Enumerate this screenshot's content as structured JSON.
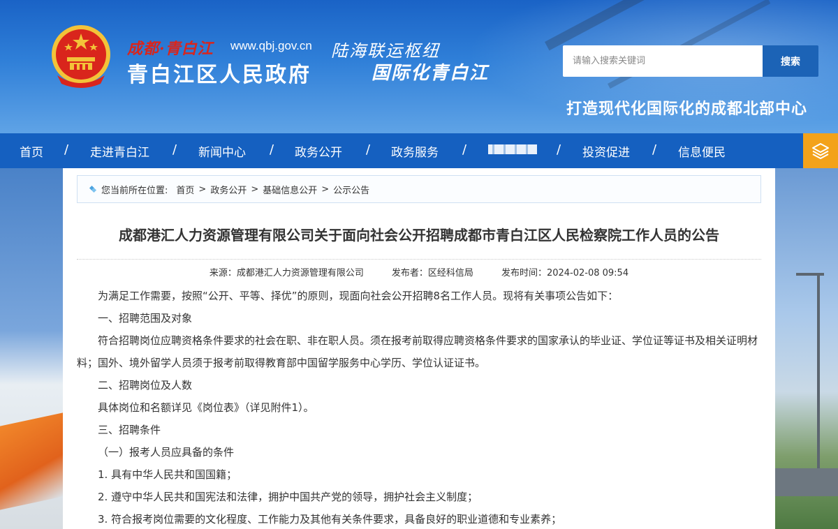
{
  "header": {
    "brand_small": "成都·青白江",
    "url": "www.qbj.gov.cn",
    "brand_main": "青白江区人民政府",
    "slogan_line1": "陆海联运枢纽",
    "slogan_line2": "国际化青白江",
    "tagline": "打造现代化国际化的成都北部中心",
    "search": {
      "placeholder": "请输入搜索关键词",
      "button_label": "搜索"
    }
  },
  "nav": {
    "items": [
      "首页",
      "走进青白江",
      "新闻中心",
      "政务公开",
      "政务服务",
      "",
      "投资促进",
      "信息便民"
    ],
    "separator": "/"
  },
  "breadcrumb": {
    "prefix": "您当前所在位置:",
    "items": [
      "首页",
      "政务公开",
      "基础信息公开",
      "公示公告"
    ],
    "arrow": ">"
  },
  "article": {
    "title": "成都港汇人力资源管理有限公司关于面向社会公开招聘成都市青白江区人民检察院工作人员的公告",
    "source": "来源：成都港汇人力资源管理有限公司",
    "publisher": "发布者：区经科信局",
    "publish_time": "发布时间：2024-02-08 09:54",
    "paragraphs": [
      "为满足工作需要，按照“公开、平等、择优”的原则，现面向社会公开招聘8名工作人员。现将有关事项公告如下：",
      "一、招聘范围及对象",
      "符合招聘岗位应聘资格条件要求的社会在职、非在职人员。须在报考前取得应聘资格条件要求的国家承认的毕业证、学位证等证书及相关证明材料；国外、境外留学人员须于报考前取得教育部中国留学服务中心学历、学位认证证书。",
      "二、招聘岗位及人数",
      "具体岗位和名额详见《岗位表》（详见附件1）。",
      "三、招聘条件",
      "（一）报考人员应具备的条件",
      "1. 具有中华人民共和国国籍；",
      "2. 遵守中华人民共和国宪法和法律，拥护中国共产党的领导，拥护社会主义制度；",
      "3. 符合报考岗位需要的文化程度、工作能力及其他有关条件要求，具备良好的职业道德和专业素养；"
    ]
  },
  "colors": {
    "nav_blue": "#1560c0",
    "search_button": "#1c63b6",
    "layers_button": "#f3a21a",
    "brand_red": "#d9251c"
  }
}
